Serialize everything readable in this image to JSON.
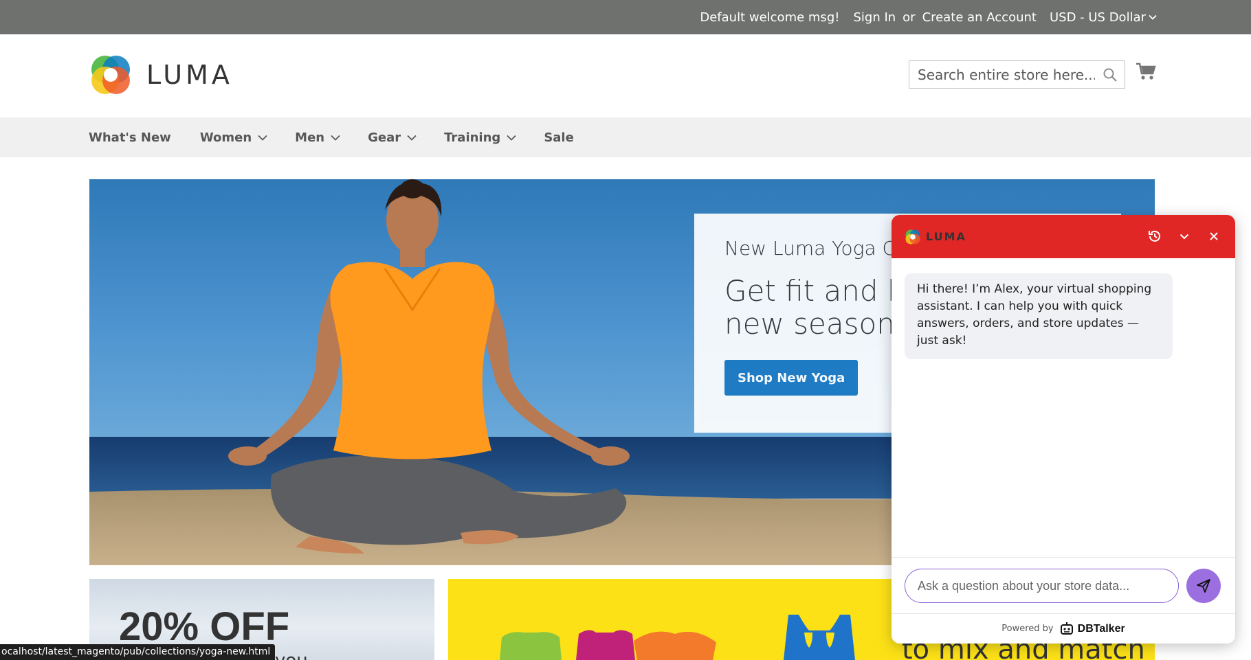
{
  "topbar": {
    "welcome": "Default welcome msg!",
    "sign_in": "Sign In",
    "or": "or",
    "create_account": "Create an Account",
    "currency": "USD - US Dollar"
  },
  "header": {
    "logo_text": "LUMA",
    "search_placeholder": "Search entire store here...",
    "icons": {
      "search": "search-icon",
      "cart": "cart-icon"
    }
  },
  "nav": {
    "items": [
      {
        "label": "What's New",
        "has_dropdown": false
      },
      {
        "label": "Women",
        "has_dropdown": true
      },
      {
        "label": "Men",
        "has_dropdown": true
      },
      {
        "label": "Gear",
        "has_dropdown": true
      },
      {
        "label": "Training",
        "has_dropdown": true
      },
      {
        "label": "Sale",
        "has_dropdown": false
      }
    ]
  },
  "hero": {
    "subtitle": "New Luma Yoga Collection",
    "title": "Get fit and look fab in new seasonal styles",
    "button": "Shop New Yoga"
  },
  "promos": {
    "left_headline": "20% OFF",
    "left_partial": "you",
    "right_partial": "to mix and match"
  },
  "status_url": "ocalhost/latest_magento/pub/collections/yoga-new.html",
  "chat": {
    "brand": "LUMA",
    "welcome_message": "Hi there! I’m Alex, your virtual shopping assistant. I can help you with quick answers, orders, and store updates — just ask!",
    "input_placeholder": "Ask a question about your store data...",
    "powered_by": "Powered by",
    "powered_brand": "DBTalker",
    "header_colour": "#e12726",
    "send_colour": "#9b6fe0",
    "icons": {
      "history": "history-icon",
      "minimize": "chevron-down-icon",
      "close": "close-icon",
      "send": "send-icon"
    }
  },
  "colors": {
    "topbar_bg": "#6e716e",
    "nav_bg": "#f0f0f0",
    "primary_button": "#1979c3"
  }
}
